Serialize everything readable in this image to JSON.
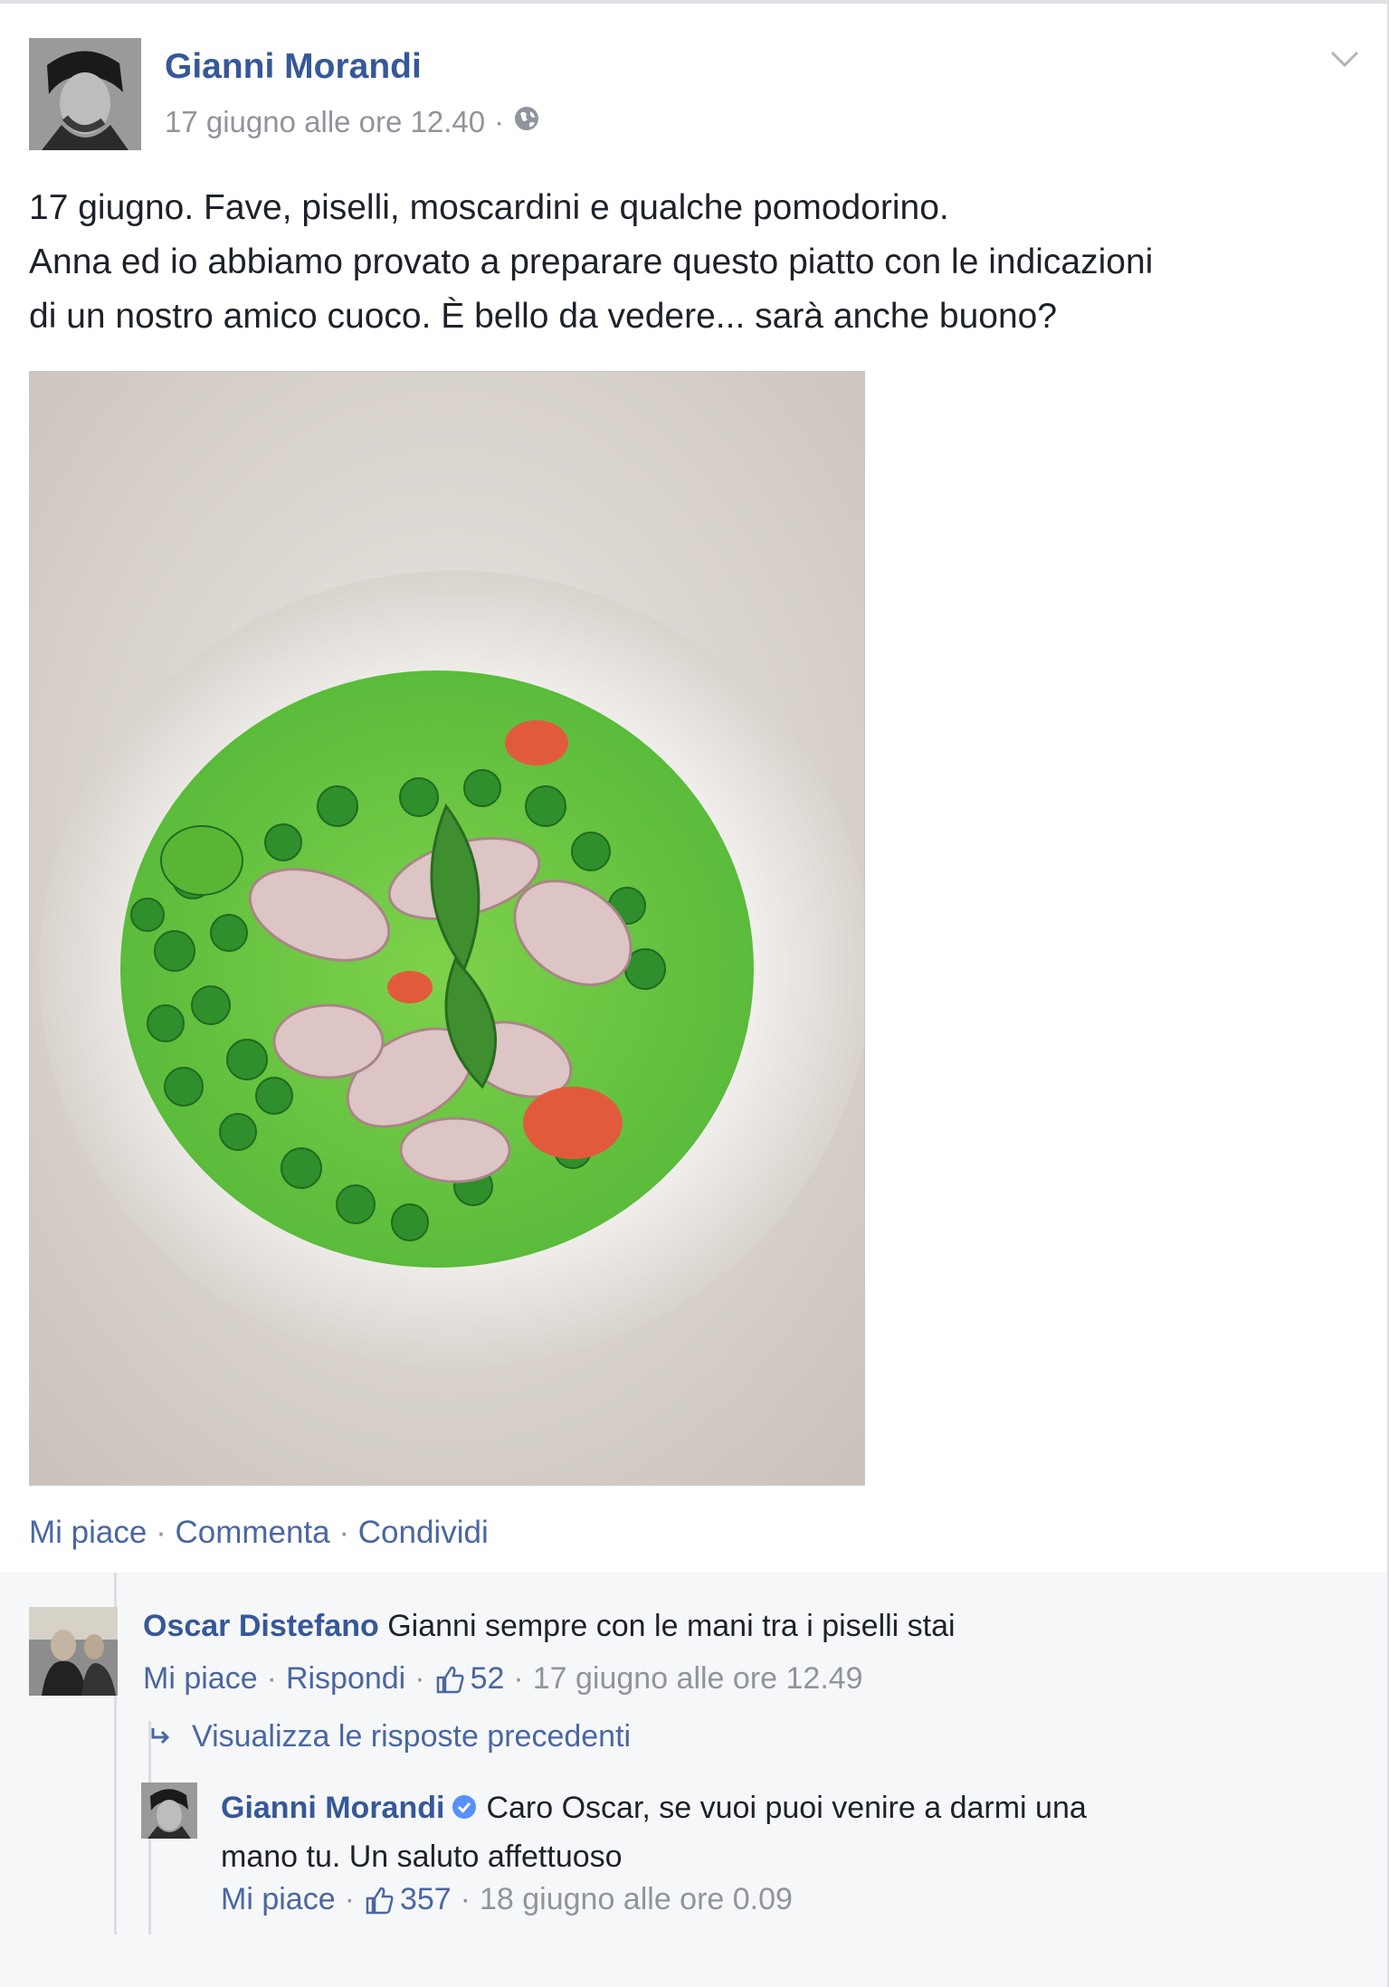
{
  "post": {
    "author": "Gianni Morandi",
    "timestamp": "17 giugno alle ore 12.40",
    "privacy_icon": "globe-icon",
    "text_lines": [
      "17 giugno. Fave, piselli, moscardini e qualche pomodorino.",
      "Anna ed io abbiamo provato a preparare questo piatto con le indicazioni",
      "di un nostro amico cuoco. È bello da vedere... sarà anche buono?"
    ],
    "actions": {
      "like": "Mi piace",
      "comment": "Commenta",
      "share": "Condividi"
    }
  },
  "comments": [
    {
      "author": "Oscar Distefano",
      "text": "Gianni sempre con le mani tra i piselli stai",
      "like_label": "Mi piace",
      "reply_label": "Rispondi",
      "likes": "52",
      "timestamp": "17 giugno alle ore 12.49"
    }
  ],
  "previous_replies": "Visualizza le risposte precedenti",
  "reply": {
    "author": "Gianni Morandi",
    "verified_icon": "verified-badge-icon",
    "text_line1": "Caro Oscar, se vuoi puoi venire a darmi una",
    "text_line2": "mano tu. Un saluto affettuoso",
    "like_label": "Mi piace",
    "likes": "357",
    "timestamp": "18 giugno alle ore 0.09"
  },
  "colors": {
    "link": "#365899",
    "secondary_text": "#90949c",
    "comments_bg": "#f6f7f9",
    "verified": "#5890ff"
  }
}
